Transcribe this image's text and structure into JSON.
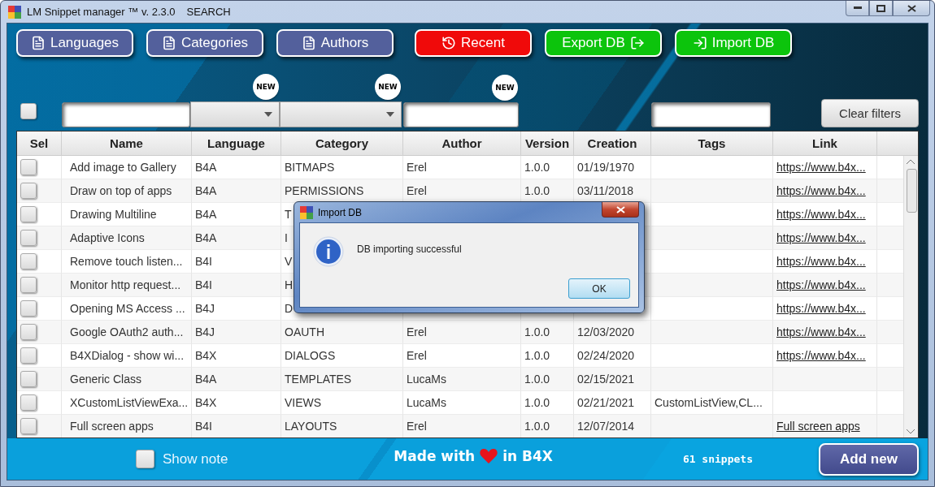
{
  "window": {
    "title": "LM Snippet manager ™ v. 2.3.0",
    "mode": "SEARCH"
  },
  "toolbar": [
    {
      "label": "Languages",
      "kind": "list",
      "color": "#53609c"
    },
    {
      "label": "Categories",
      "kind": "list",
      "color": "#53609c"
    },
    {
      "label": "Authors",
      "kind": "list",
      "color": "#53609c"
    },
    {
      "label": "Recent",
      "kind": "recent",
      "color": "#f00a0a"
    },
    {
      "label": "Export DB",
      "kind": "export",
      "color": "#0cc40c"
    },
    {
      "label": "Import DB",
      "kind": "import",
      "color": "#0cc40c"
    }
  ],
  "filters": {
    "select_all": {
      "checked": false
    },
    "fields": [
      {
        "kind": "text"
      },
      {
        "kind": "combo",
        "badge": "NEW"
      },
      {
        "kind": "combo",
        "badge": "NEW"
      },
      {
        "kind": "text",
        "badge": "NEW"
      },
      {
        "kind": "text"
      }
    ],
    "clear_button": "Clear filters"
  },
  "table": {
    "select_header": "Sel",
    "columns": [
      {
        "label": "Name",
        "kind": "text"
      },
      {
        "label": "Language",
        "kind": "text"
      },
      {
        "label": "Category",
        "kind": "text"
      },
      {
        "label": "Author",
        "kind": "text"
      },
      {
        "label": "Version",
        "kind": "text"
      },
      {
        "label": "Creation",
        "kind": "text"
      },
      {
        "label": "Tags",
        "kind": "text"
      },
      {
        "label": "Link",
        "kind": "link"
      }
    ],
    "rows": [
      {
        "checked": false,
        "cells": [
          "Add image to Gallery",
          "B4A",
          "BITMAPS",
          "Erel",
          "1.0.0",
          "01/19/1970",
          null,
          "https://www.b4x..."
        ]
      },
      {
        "checked": false,
        "cells": [
          "Draw on top of apps",
          "B4A",
          "PERMISSIONS",
          "Erel",
          "1.0.0",
          "03/11/2018",
          null,
          "https://www.b4x..."
        ]
      },
      {
        "checked": false,
        "cells": [
          "Drawing Multiline",
          "B4A",
          "T",
          null,
          null,
          null,
          null,
          "https://www.b4x..."
        ]
      },
      {
        "checked": false,
        "cells": [
          "Adaptive Icons",
          "B4A",
          "I",
          null,
          null,
          null,
          null,
          "https://www.b4x..."
        ]
      },
      {
        "checked": false,
        "cells": [
          "Remove touch listen...",
          "B4I",
          "V",
          null,
          null,
          null,
          null,
          "https://www.b4x..."
        ]
      },
      {
        "checked": false,
        "cells": [
          "Monitor http request...",
          "B4I",
          "H",
          null,
          null,
          null,
          null,
          "https://www.b4x..."
        ]
      },
      {
        "checked": false,
        "cells": [
          "Opening MS Access ...",
          "B4J",
          "D",
          null,
          null,
          null,
          null,
          "https://www.b4x..."
        ]
      },
      {
        "checked": false,
        "cells": [
          "Google OAuth2 auth...",
          "B4J",
          "OAUTH",
          "Erel",
          "1.0.0",
          "12/03/2020",
          null,
          "https://www.b4x..."
        ]
      },
      {
        "checked": false,
        "cells": [
          "B4XDialog - show wi...",
          "B4X",
          "DIALOGS",
          "Erel",
          "1.0.0",
          "02/24/2020",
          null,
          "https://www.b4x..."
        ]
      },
      {
        "checked": false,
        "cells": [
          "Generic Class",
          "B4A",
          "TEMPLATES",
          "LucaMs",
          "1.0.0",
          "02/15/2021",
          null,
          null
        ]
      },
      {
        "checked": false,
        "cells": [
          "XCustomListViewExa...",
          "B4X",
          "VIEWS",
          "LucaMs",
          "1.0.0",
          "02/21/2021",
          "CustomListView,CL...",
          null
        ]
      },
      {
        "checked": false,
        "cells": [
          "Full screen apps",
          "B4I",
          "LAYOUTS",
          "Erel",
          "1.0.0",
          "12/07/2014",
          null,
          "Full screen apps"
        ]
      }
    ]
  },
  "footer": {
    "show_note": {
      "label": "Show note",
      "checked": false
    },
    "made_with": {
      "before": "Made with",
      "after": "in B4X"
    },
    "count": "61 snippets",
    "add_button": "Add new"
  },
  "dialog": {
    "title": "Import DB",
    "message": "DB importing successful",
    "button": "OK"
  }
}
